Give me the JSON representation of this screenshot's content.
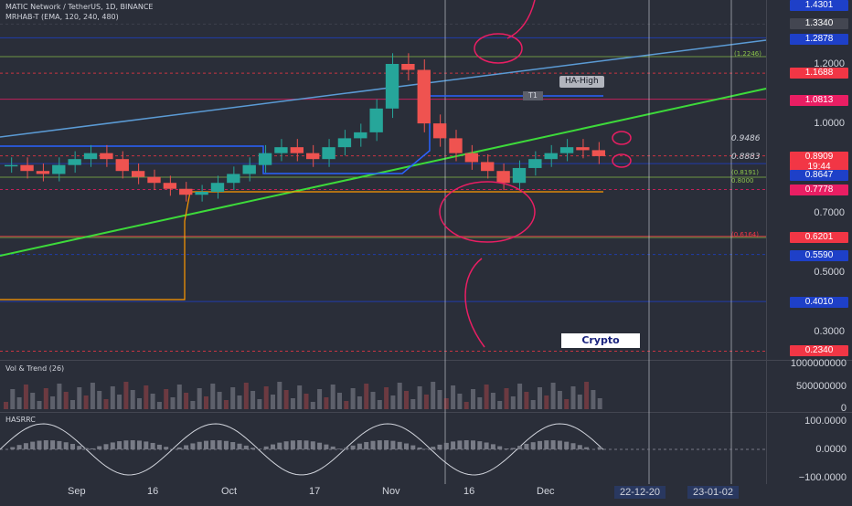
{
  "header": {
    "symbol": "MATIC Network / TetherUS, 1D, BINANCE",
    "indicator": "MRHAB-T (EMA, 120, 240, 480)",
    "vol_title": "Vol & Trend (26)",
    "osc_title": "HASRRC"
  },
  "price_axis": {
    "ticks": [
      "1.2000",
      "1.0000",
      "0.7000",
      "0.5000",
      "0.3000"
    ],
    "badges": [
      {
        "label": "1.4301",
        "color": "#1e40c8"
      },
      {
        "label": "1.3340",
        "color": "#434651"
      },
      {
        "label": "1.2878",
        "color": "#1e40c8"
      },
      {
        "label": "1.1688",
        "color": "#f23645"
      },
      {
        "label": "1.0813",
        "color": "#e91e63"
      },
      {
        "label": "0.8909",
        "color": "#f23645"
      },
      {
        "label": "19:44",
        "color": "#f23645"
      },
      {
        "label": "0.8647",
        "color": "#1e40c8"
      },
      {
        "label": "0.7778",
        "color": "#e91e63"
      },
      {
        "label": "0.6201",
        "color": "#f23645"
      },
      {
        "label": "0.5590",
        "color": "#1e40c8"
      },
      {
        "label": "0.4010",
        "color": "#1e40c8"
      },
      {
        "label": "0.2340",
        "color": "#f23645"
      }
    ]
  },
  "annotations": {
    "fib_1": "(1.2246)",
    "ha_high": "HA-High",
    "t1": "T1",
    "lvl_9486": "0.9486",
    "lvl_8883": "0.8883",
    "fib_2": "(0.8191)",
    "fib_3": "0.8000",
    "fib_4": "(0.6164)",
    "logo": "Crypto"
  },
  "vol_axis": {
    "ticks": [
      "1000000000",
      "500000000",
      "0"
    ]
  },
  "osc_axis": {
    "ticks": [
      "100.0000",
      "0.0000",
      "−100.0000"
    ]
  },
  "time_axis": {
    "ticks": [
      "Sep",
      "16",
      "Oct",
      "17",
      "Nov",
      "16",
      "Dec"
    ],
    "range_tags": [
      "22-12-20",
      "23-01-02"
    ]
  },
  "colors": {
    "bg": "#2a2e39",
    "up": "#26a69a",
    "down": "#ef5350",
    "trend_green": "#3dda3a",
    "trend_blue": "#5b9bd5",
    "annotation_pink": "#e91e63"
  },
  "chart_data": {
    "type": "candlestick",
    "symbol": "MATIC/USDT",
    "interval": "1D",
    "ylim": [
      0.2,
      1.45
    ],
    "price_levels": [
      1.4301,
      1.334,
      1.2878,
      1.1688,
      1.0813,
      0.8909,
      0.8647,
      0.7778,
      0.6201,
      0.559,
      0.401,
      0.234
    ],
    "approx_close_trend": [
      0.86,
      0.84,
      0.83,
      0.86,
      0.88,
      0.9,
      0.88,
      0.84,
      0.82,
      0.8,
      0.78,
      0.76,
      0.77,
      0.8,
      0.83,
      0.86,
      0.9,
      0.92,
      0.9,
      0.88,
      0.92,
      0.95,
      0.97,
      1.05,
      1.2,
      1.18,
      1.0,
      0.95,
      0.9,
      0.87,
      0.84,
      0.8,
      0.85,
      0.88,
      0.9,
      0.92,
      0.91,
      0.89
    ],
    "volume_ylim": [
      0,
      1000000000
    ],
    "oscillator_ylim": [
      -100,
      100
    ]
  }
}
